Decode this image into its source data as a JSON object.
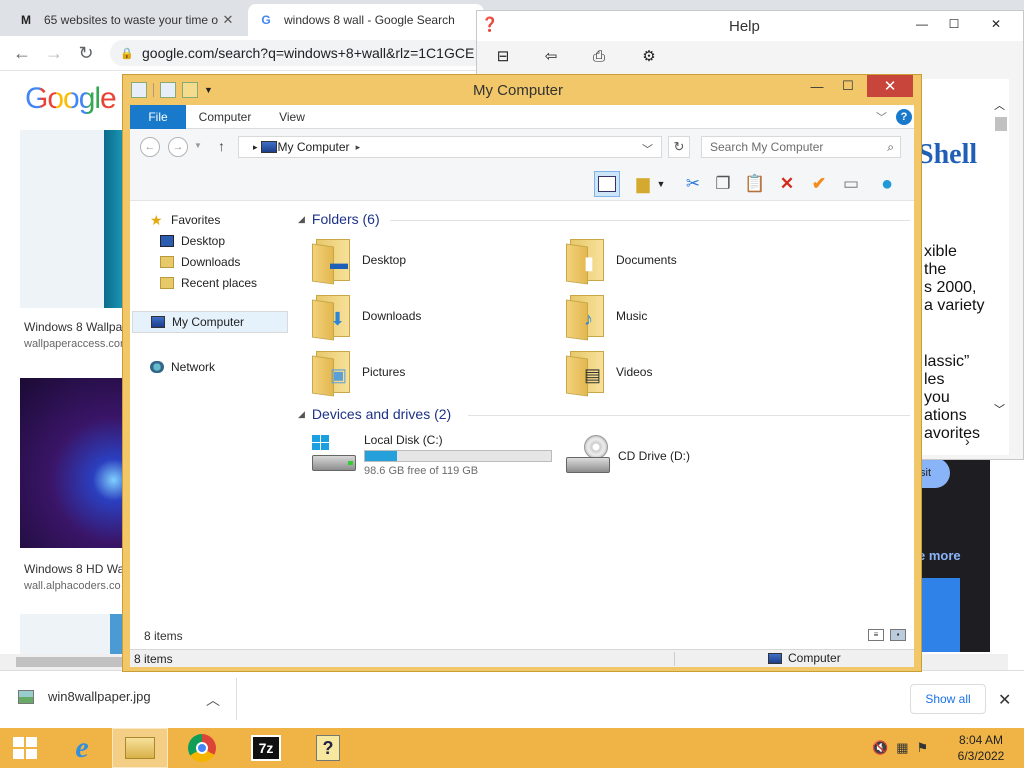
{
  "chrome": {
    "tabs": [
      {
        "title": "65 websites to waste your time o",
        "active": false
      },
      {
        "title": "windows 8 wall - Google Search",
        "active": true
      }
    ],
    "url": "google.com/search?q=windows+8+wall&rlz=1C1GCE",
    "logo": "Google",
    "results": [
      {
        "title": "Windows 8 Wallpa",
        "source": "wallpaperaccess.com"
      },
      {
        "title": "Windows 8 HD Wa",
        "source": "wall.alphacoders.co"
      }
    ],
    "right_btn": "sit",
    "right_more": "e more",
    "download": {
      "filename": "win8wallpaper.jpg",
      "show_all": "Show all"
    }
  },
  "help": {
    "title": "Help",
    "heading": "Shell",
    "lines": [
      "xible",
      "the",
      "s 2000,",
      "a variety",
      "lassic”",
      "les",
      "you",
      "ations",
      "avorites"
    ]
  },
  "explorer": {
    "title": "My Computer",
    "ribbon_tabs": {
      "file": "File",
      "computer": "Computer",
      "view": "View"
    },
    "address": "My Computer",
    "search_placeholder": "Search My Computer",
    "nav": {
      "favorites": "Favorites",
      "desktop": "Desktop",
      "downloads": "Downloads",
      "recent": "Recent places",
      "my_computer": "My Computer",
      "network": "Network"
    },
    "folders_header": "Folders (6)",
    "folders": [
      {
        "name": "Desktop"
      },
      {
        "name": "Documents"
      },
      {
        "name": "Downloads"
      },
      {
        "name": "Music"
      },
      {
        "name": "Pictures"
      },
      {
        "name": "Videos"
      }
    ],
    "drives_header": "Devices and drives (2)",
    "drives": [
      {
        "name": "Local Disk (C:)",
        "free": "98.6 GB free of 119 GB",
        "used_fraction": 0.171
      },
      {
        "name": "CD Drive (D:)"
      }
    ],
    "item_count": "8 items",
    "status_count": "8 items",
    "status_location": "Computer"
  },
  "taskbar": {
    "time": "8:04 AM",
    "date": "6/3/2022"
  },
  "colors": {
    "accent": "#1979ca",
    "window_frame": "#f1c76a",
    "taskbar": "#f0b446",
    "close": "#c7453b"
  }
}
